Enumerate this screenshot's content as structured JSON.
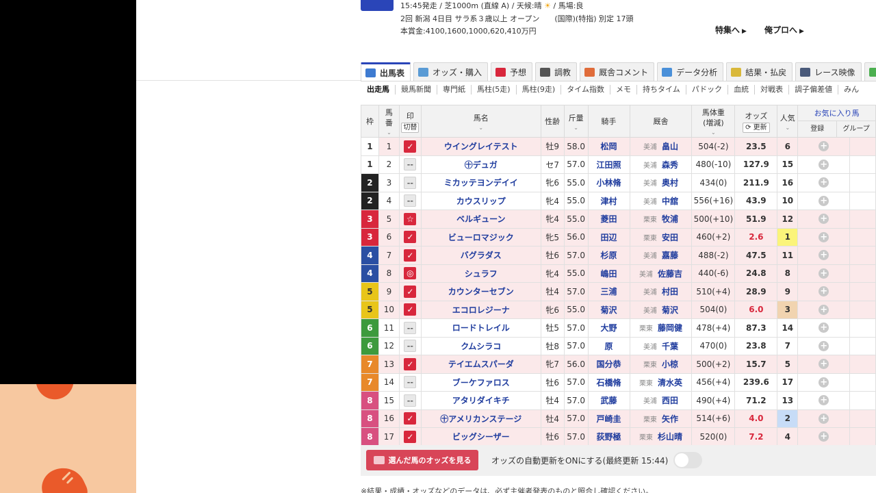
{
  "race": {
    "line1": "15:45発走 / 芝1000m (直線 A) / 天候:晴",
    "sun": "☀",
    "line1_tail": "/ 馬場:良",
    "line2_a": "2回 新潟 4日目 サラ系３歳以上 オープン",
    "line2_b": "(国際)(特指) 別定 17頭",
    "line3": "本賞金:4100,1600,1000,620,410万円"
  },
  "links": {
    "feature": "特集へ",
    "pro": "俺プロへ",
    "arrow": "▶"
  },
  "tabs": [
    {
      "label": "出馬表",
      "icon": "table-icon",
      "color": "#3e7bd1"
    },
    {
      "label": "オッズ・購入",
      "icon": "odds-icon",
      "color": "#5a9bd5"
    },
    {
      "label": "予想",
      "icon": "target-icon",
      "color": "#d8273c"
    },
    {
      "label": "調教",
      "icon": "stopwatch-icon",
      "color": "#555555"
    },
    {
      "label": "厩舎コメント",
      "icon": "comment-icon",
      "color": "#e06c3a"
    },
    {
      "label": "データ分析",
      "icon": "chart-icon",
      "color": "#4a90d9"
    },
    {
      "label": "結果・払戻",
      "icon": "coins-icon",
      "color": "#d9b83a"
    },
    {
      "label": "レース映像",
      "icon": "video-icon",
      "color": "#4a5a7a"
    },
    {
      "label": "",
      "icon": "more-icon",
      "color": "#4caf50"
    }
  ],
  "subtabs": [
    "出走馬",
    "競馬新聞",
    "専門紙",
    "馬柱(5走)",
    "馬柱(9走)",
    "タイム指数",
    "メモ",
    "持ちタイム",
    "パドック",
    "血統",
    "対戦表",
    "調子偏差値",
    "みん"
  ],
  "headers": {
    "waku": "枠",
    "umaban1": "馬",
    "umaban2": "番",
    "mark": "印",
    "kirikae": "切替",
    "name": "馬名",
    "sexage": "性齢",
    "weight": "斤量",
    "jockey": "騎手",
    "trainer": "厩舎",
    "hw1": "馬体重",
    "hw2": "(増減)",
    "odds": "オッズ",
    "refresh": "更新",
    "pop": "人気",
    "fav": "お気に入り馬",
    "reg": "登録",
    "group": "グループ",
    "sort": "⌄"
  },
  "waku_colors": {
    "1": {
      "bg": "#ffffff",
      "fg": "#333333"
    },
    "2": {
      "bg": "#222222",
      "fg": "#ffffff"
    },
    "3": {
      "bg": "#d8273c",
      "fg": "#ffffff"
    },
    "4": {
      "bg": "#2a4fa3",
      "fg": "#ffffff"
    },
    "5": {
      "bg": "#e8c51a",
      "fg": "#333333"
    },
    "6": {
      "bg": "#3d9a3d",
      "fg": "#ffffff"
    },
    "7": {
      "bg": "#e8892a",
      "fg": "#ffffff"
    },
    "8": {
      "bg": "#d85080",
      "fg": "#ffffff"
    }
  },
  "marks": {
    "check": "✓",
    "star": "☆",
    "circ": "◎",
    "none": "--",
    "plus": "+"
  },
  "horses": [
    {
      "waku": "1",
      "num": "1",
      "mark": "check",
      "name": "ウイングレイテスト",
      "sexage": "牡9",
      "weight": "58.0",
      "jockey": "松岡",
      "region": "美浦",
      "trainer": "畠山",
      "hw": "504(-2)",
      "odds": "23.5",
      "pop": "6",
      "marked": true
    },
    {
      "waku": "1",
      "num": "2",
      "mark": "none",
      "name": "㊉デュガ",
      "sexage": "セ7",
      "weight": "57.0",
      "jockey": "江田照",
      "region": "美浦",
      "trainer": "森秀",
      "hw": "480(-10)",
      "odds": "127.9",
      "pop": "15",
      "marked": false
    },
    {
      "waku": "2",
      "num": "3",
      "mark": "none",
      "name": "ミカッテヨンデイイ",
      "sexage": "牝6",
      "weight": "55.0",
      "jockey": "小林脩",
      "region": "美浦",
      "trainer": "奥村",
      "hw": "434(0)",
      "odds": "211.9",
      "pop": "16",
      "marked": false
    },
    {
      "waku": "2",
      "num": "4",
      "mark": "none",
      "name": "カウスリップ",
      "sexage": "牝4",
      "weight": "55.0",
      "jockey": "津村",
      "region": "美浦",
      "trainer": "中舘",
      "hw": "556(+16)",
      "odds": "43.9",
      "pop": "10",
      "marked": false
    },
    {
      "waku": "3",
      "num": "5",
      "mark": "star",
      "name": "ベルギューン",
      "sexage": "牝4",
      "weight": "55.0",
      "jockey": "菱田",
      "region": "栗東",
      "trainer": "牧浦",
      "hw": "500(+10)",
      "odds": "51.9",
      "pop": "12",
      "marked": true
    },
    {
      "waku": "3",
      "num": "6",
      "mark": "check",
      "name": "ビューロマジック",
      "sexage": "牝5",
      "weight": "56.0",
      "jockey": "田辺",
      "region": "栗東",
      "trainer": "安田",
      "hw": "460(+2)",
      "odds": "2.6",
      "pop": "1",
      "marked": true,
      "hot": true,
      "popcls": "p1"
    },
    {
      "waku": "4",
      "num": "7",
      "mark": "check",
      "name": "バグラダス",
      "sexage": "牡6",
      "weight": "57.0",
      "jockey": "杉原",
      "region": "美浦",
      "trainer": "嘉藤",
      "hw": "488(-2)",
      "odds": "47.5",
      "pop": "11",
      "marked": true
    },
    {
      "waku": "4",
      "num": "8",
      "mark": "circ",
      "name": "シュラフ",
      "sexage": "牝4",
      "weight": "55.0",
      "jockey": "嶋田",
      "region": "美浦",
      "trainer": "佐藤吉",
      "hw": "440(-6)",
      "odds": "24.8",
      "pop": "8",
      "marked": true
    },
    {
      "waku": "5",
      "num": "9",
      "mark": "check",
      "name": "カウンターセブン",
      "sexage": "牡4",
      "weight": "57.0",
      "jockey": "三浦",
      "region": "美浦",
      "trainer": "村田",
      "hw": "510(+4)",
      "odds": "28.9",
      "pop": "9",
      "marked": true
    },
    {
      "waku": "5",
      "num": "10",
      "mark": "check",
      "name": "エコロレジーナ",
      "sexage": "牝6",
      "weight": "55.0",
      "jockey": "菊沢",
      "region": "美浦",
      "trainer": "菊沢",
      "hw": "504(0)",
      "odds": "6.0",
      "pop": "3",
      "marked": true,
      "hot": true,
      "popcls": "p3"
    },
    {
      "waku": "6",
      "num": "11",
      "mark": "none",
      "name": "ロードトレイル",
      "sexage": "牡5",
      "weight": "57.0",
      "jockey": "大野",
      "region": "栗東",
      "trainer": "藤岡健",
      "hw": "478(+4)",
      "odds": "87.3",
      "pop": "14",
      "marked": false
    },
    {
      "waku": "6",
      "num": "12",
      "mark": "none",
      "name": "クムシラコ",
      "sexage": "牡8",
      "weight": "57.0",
      "jockey": "原",
      "region": "美浦",
      "trainer": "千葉",
      "hw": "470(0)",
      "odds": "23.8",
      "pop": "7",
      "marked": false
    },
    {
      "waku": "7",
      "num": "13",
      "mark": "check",
      "name": "テイエムスパーダ",
      "sexage": "牝7",
      "weight": "56.0",
      "jockey": "国分恭",
      "region": "栗東",
      "trainer": "小椋",
      "hw": "500(+2)",
      "odds": "15.7",
      "pop": "5",
      "marked": true
    },
    {
      "waku": "7",
      "num": "14",
      "mark": "none",
      "name": "ブーケファロス",
      "sexage": "牡6",
      "weight": "57.0",
      "jockey": "石橋脩",
      "region": "栗東",
      "trainer": "清水英",
      "hw": "456(+4)",
      "odds": "239.6",
      "pop": "17",
      "marked": false
    },
    {
      "waku": "8",
      "num": "15",
      "mark": "none",
      "name": "アタリダイキチ",
      "sexage": "牡4",
      "weight": "57.0",
      "jockey": "武藤",
      "region": "美浦",
      "trainer": "西田",
      "hw": "490(+4)",
      "odds": "71.2",
      "pop": "13",
      "marked": false
    },
    {
      "waku": "8",
      "num": "16",
      "mark": "check",
      "name": "㊉アメリカンステージ",
      "sexage": "牡4",
      "weight": "57.0",
      "jockey": "戸崎圭",
      "region": "栗東",
      "trainer": "矢作",
      "hw": "514(+6)",
      "odds": "4.0",
      "pop": "2",
      "marked": true,
      "hot": true,
      "popcls": "p2"
    },
    {
      "waku": "8",
      "num": "17",
      "mark": "check",
      "name": "ビッグシーザー",
      "sexage": "牡6",
      "weight": "57.0",
      "jockey": "荻野極",
      "region": "栗東",
      "trainer": "杉山晴",
      "hw": "520(0)",
      "odds": "7.2",
      "pop": "4",
      "marked": true,
      "hot": true
    }
  ],
  "bottom": {
    "odds_button": "選んだ馬のオッズを見る",
    "auto_update": "オッズの自動更新をONにする(最終更新 15:44)"
  },
  "footnote": "※結果・成績・オッズなどのデータは、必ず主催者発表のものと照合し確認ください。"
}
